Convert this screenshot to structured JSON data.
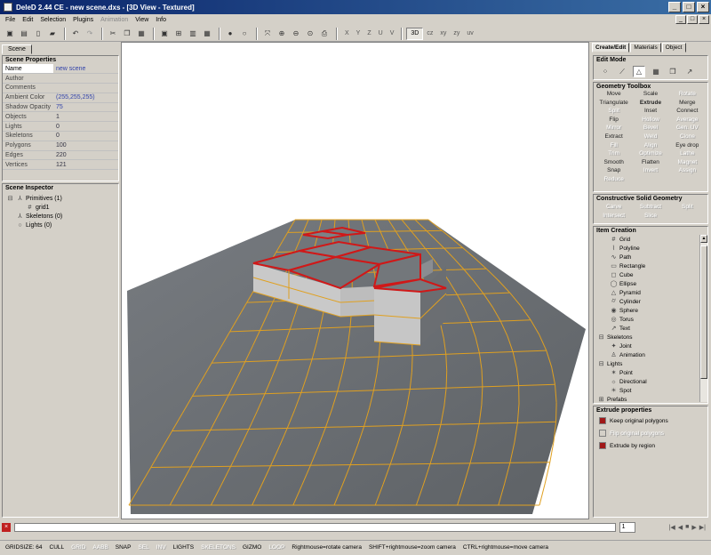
{
  "window": {
    "title": "DeleD 2.44 CE - new scene.dxs - [3D View - Textured]",
    "controls": [
      "_",
      "□",
      "×"
    ],
    "mdi_controls": [
      "_",
      "□",
      "×"
    ]
  },
  "menubar": {
    "items": [
      {
        "label": "File",
        "enabled": true
      },
      {
        "label": "Edit",
        "enabled": true
      },
      {
        "label": "Selection",
        "enabled": true
      },
      {
        "label": "Plugins",
        "enabled": true
      },
      {
        "label": "Animation",
        "enabled": false
      },
      {
        "label": "View",
        "enabled": true
      },
      {
        "label": "Info",
        "enabled": true
      }
    ]
  },
  "toolbar": {
    "axis_buttons": [
      "X",
      "Y",
      "Z",
      "U",
      "V"
    ],
    "view_buttons": [
      "3D",
      "cz",
      "xy",
      "zy",
      "uv"
    ]
  },
  "left": {
    "tab": "Scene",
    "scene_properties": {
      "title": "Scene Properties",
      "rows": [
        {
          "key": "Name",
          "value": "new scene",
          "blue": true
        },
        {
          "key": "Author",
          "value": ""
        },
        {
          "key": "Comments",
          "value": ""
        },
        {
          "key": "Ambient Color",
          "value": "(255,255,255)",
          "blue": true
        },
        {
          "key": "Shadow Opacity",
          "value": "75",
          "blue": true
        },
        {
          "key": "Objects",
          "value": "1"
        },
        {
          "key": "Lights",
          "value": "0"
        },
        {
          "key": "Skeletons",
          "value": "0"
        },
        {
          "key": "Polygons",
          "value": "100"
        },
        {
          "key": "Edges",
          "value": "220"
        },
        {
          "key": "Vertices",
          "value": "121"
        }
      ]
    },
    "scene_inspector": {
      "title": "Scene Inspector",
      "items": [
        {
          "label": "Primitives (1)",
          "indent": 0,
          "icon": "⊟"
        },
        {
          "label": "grid1",
          "indent": 2,
          "icon": "#"
        },
        {
          "label": "Skeletons (0)",
          "indent": 1,
          "icon": "⅄"
        },
        {
          "label": "Lights (0)",
          "indent": 1,
          "icon": "○"
        }
      ]
    }
  },
  "right": {
    "tabs": [
      "Create/Edit",
      "Materials",
      "Object"
    ],
    "edit_mode": {
      "title": "Edit Mode",
      "buttons": [
        "vertex",
        "edge",
        "polygon",
        "object",
        "group",
        "pivot"
      ],
      "active_index": 2
    },
    "geometry_toolbox": {
      "title": "Geometry Toolbox",
      "tools": [
        {
          "label": "Move",
          "enabled": true
        },
        {
          "label": "Scale",
          "enabled": true
        },
        {
          "label": "Rotate",
          "enabled": false
        },
        {
          "label": "Triangulate",
          "enabled": true
        },
        {
          "label": "Extrude",
          "enabled": true,
          "bold": true
        },
        {
          "label": "Merge",
          "enabled": true
        },
        {
          "label": "Split",
          "enabled": false
        },
        {
          "label": "Inset",
          "enabled": true
        },
        {
          "label": "Connect",
          "enabled": true
        },
        {
          "label": "Flip",
          "enabled": true
        },
        {
          "label": "Hollow",
          "enabled": false
        },
        {
          "label": "Average",
          "enabled": false
        },
        {
          "label": "Mirror",
          "enabled": false
        },
        {
          "label": "Bevel",
          "enabled": false
        },
        {
          "label": "Gen. UV",
          "enabled": false
        },
        {
          "label": "Extract",
          "enabled": true
        },
        {
          "label": "Weld",
          "enabled": false
        },
        {
          "label": "Clone",
          "enabled": false
        },
        {
          "label": "Fill",
          "enabled": false
        },
        {
          "label": "Align",
          "enabled": false
        },
        {
          "label": "Eye drop",
          "enabled": true
        },
        {
          "label": "Trim",
          "enabled": false
        },
        {
          "label": "Optimize",
          "enabled": false
        },
        {
          "label": "Lathe",
          "enabled": false
        },
        {
          "label": "Smooth",
          "enabled": true
        },
        {
          "label": "Flatten",
          "enabled": true
        },
        {
          "label": "Magnet",
          "enabled": false
        },
        {
          "label": "Snap",
          "enabled": true
        },
        {
          "label": "Invert",
          "enabled": false
        },
        {
          "label": "Assign",
          "enabled": false
        },
        {
          "label": "Reduce",
          "enabled": false
        },
        {
          "label": "",
          "enabled": false
        },
        {
          "label": "",
          "enabled": false
        }
      ]
    },
    "csg": {
      "title": "Constructive Solid Geometry",
      "tools": [
        "Carve",
        "Subtract",
        "Split",
        "Intersect",
        "Slice",
        ""
      ]
    },
    "item_creation": {
      "title": "Item Creation",
      "items": [
        {
          "label": "Grid",
          "indent": 2,
          "icon": "#"
        },
        {
          "label": "Polyline",
          "indent": 2,
          "icon": "⌇"
        },
        {
          "label": "Path",
          "indent": 2,
          "icon": "∿"
        },
        {
          "label": "Rectangle",
          "indent": 2,
          "icon": "▭"
        },
        {
          "label": "Cube",
          "indent": 2,
          "icon": "◻"
        },
        {
          "label": "Ellipse",
          "indent": 2,
          "icon": "◯"
        },
        {
          "label": "Pyramid",
          "indent": 2,
          "icon": "△"
        },
        {
          "label": "Cylinder",
          "indent": 2,
          "icon": "⌭"
        },
        {
          "label": "Sphere",
          "indent": 2,
          "icon": "◉"
        },
        {
          "label": "Torus",
          "indent": 2,
          "icon": "◎"
        },
        {
          "label": "Text",
          "indent": 2,
          "icon": "↗"
        },
        {
          "label": "Skeletons",
          "indent": 0,
          "icon": "⊟"
        },
        {
          "label": "Joint",
          "indent": 2,
          "icon": "✦"
        },
        {
          "label": "Animation",
          "indent": 2,
          "icon": "♙"
        },
        {
          "label": "Lights",
          "indent": 0,
          "icon": "⊟"
        },
        {
          "label": "Point",
          "indent": 2,
          "icon": "✶"
        },
        {
          "label": "Directional",
          "indent": 2,
          "icon": "☼"
        },
        {
          "label": "Spot",
          "indent": 2,
          "icon": "☀"
        },
        {
          "label": "Prefabs",
          "indent": 0,
          "icon": "⊞"
        }
      ]
    },
    "extrude_properties": {
      "title": "Extrude properties",
      "options": [
        {
          "label": "Keep original polygons",
          "checked": true,
          "enabled": true
        },
        {
          "label": "Flip original polygons",
          "checked": false,
          "enabled": false
        },
        {
          "label": "Extrude by region",
          "checked": true,
          "enabled": true
        }
      ]
    }
  },
  "console": {
    "close_label": "×",
    "frame_value": "1",
    "play_buttons": [
      "|◀",
      "◀",
      "■",
      "▶",
      "▶|"
    ]
  },
  "statusbar": {
    "items": [
      {
        "label": "GRIDSIZE: 64",
        "enabled": true
      },
      {
        "label": "CULL",
        "enabled": true
      },
      {
        "label": "GRID",
        "enabled": false
      },
      {
        "label": "AABB",
        "enabled": false
      },
      {
        "label": "SNAP",
        "enabled": true
      },
      {
        "label": "SEL",
        "enabled": false
      },
      {
        "label": "INV",
        "enabled": false
      },
      {
        "label": "LIGHTS",
        "enabled": true
      },
      {
        "label": "SKELETONS",
        "enabled": false
      },
      {
        "label": "GIZMO",
        "enabled": true
      },
      {
        "label": "LOOP",
        "enabled": false
      },
      {
        "label": "Rightmouse=rotate camera",
        "enabled": true
      },
      {
        "label": "SHIFT+rightmouse=zoom camera",
        "enabled": true
      },
      {
        "label": "CTRL+rightmouse=move camera",
        "enabled": true
      }
    ]
  },
  "colors": {
    "title_start": "#0a246a",
    "title_end": "#3a6ea5",
    "grid_line": "#e0a020",
    "selection_edge": "#d01818",
    "floor_tile": "#6a6e72",
    "raised_top": "#75797e",
    "raised_side": "#c8c8c8",
    "checkbox_checked": "#a01818"
  }
}
